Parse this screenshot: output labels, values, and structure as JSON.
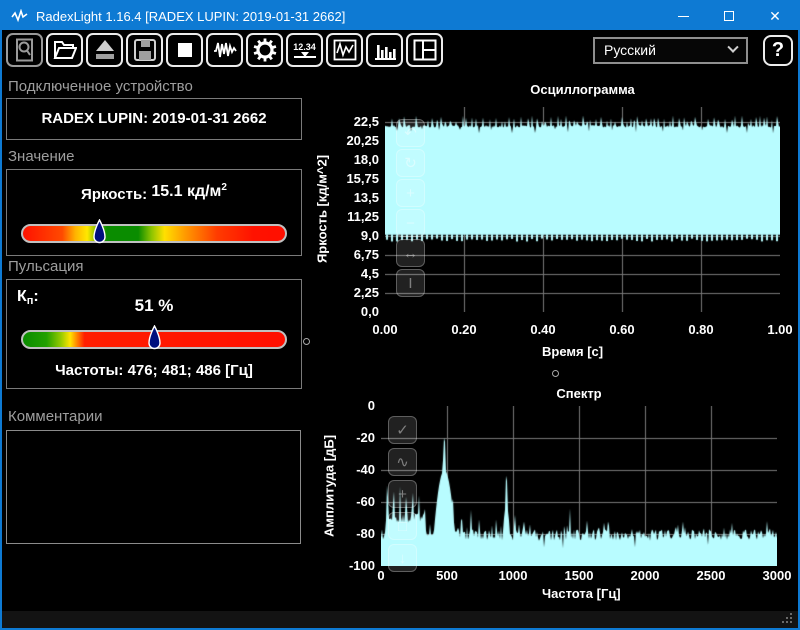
{
  "window": {
    "title": "RadexLight 1.16.4 [RADEX LUPIN: 2019-01-31 2662]",
    "controls": [
      "minimize",
      "maximize",
      "close"
    ]
  },
  "toolbar": {
    "icons": [
      "search-icon",
      "open-folder-icon",
      "eject-icon",
      "save-icon",
      "stop-icon",
      "waveform-icon",
      "gear-icon",
      "numeric-display-icon",
      "line-chart-icon",
      "bar-chart-icon",
      "layout-icon"
    ],
    "numeric_icon_text": "12.34",
    "language_value": "Русский",
    "help_label": "?"
  },
  "panels": {
    "device": {
      "header": "Подключенное устройство",
      "name": "RADEX LUPIN: 2019-01-31 2662"
    },
    "value": {
      "header": "Значение",
      "label": "Яркость:",
      "value": "15.1",
      "unit": "кд/м",
      "sup": "2",
      "bar": {
        "marker_pos_pct": 29,
        "marker_color": "#000f7e",
        "stops": [
          [
            0,
            "#ff1200"
          ],
          [
            0.15,
            "#ff4a00"
          ],
          [
            0.2,
            "#ffb300"
          ],
          [
            0.245,
            "#ffe800"
          ],
          [
            0.29,
            "#63b400"
          ],
          [
            0.32,
            "#0a8c00"
          ],
          [
            0.44,
            "#0a8c00"
          ],
          [
            0.49,
            "#8cc400"
          ],
          [
            0.54,
            "#ffe000"
          ],
          [
            0.62,
            "#ff9900"
          ],
          [
            0.74,
            "#ff3c00"
          ],
          [
            0.88,
            "#ff1200"
          ],
          [
            1,
            "#ff0f00"
          ]
        ]
      }
    },
    "pulsation": {
      "header": "Пульсация",
      "kp_letter": "К",
      "kp_sub": "п",
      "kp_colon": ":",
      "value": "51 %",
      "frequencies": "Частоты: 476; 481; 486 [Гц]",
      "bar": {
        "marker_pos_pct": 50,
        "marker_color": "#000f7e",
        "stops": [
          [
            0,
            "#0a8c00"
          ],
          [
            0.09,
            "#23a000"
          ],
          [
            0.145,
            "#96ca00"
          ],
          [
            0.18,
            "#ffe400"
          ],
          [
            0.205,
            "#ff8800"
          ],
          [
            0.235,
            "#ff1e00"
          ],
          [
            1,
            "#ff0f00"
          ]
        ]
      }
    },
    "comments": {
      "header": "Комментарии",
      "text": ""
    }
  },
  "charts": {
    "oscillogram": {
      "type": "area",
      "title": "Осциллограмма",
      "ylabel": "Яркость [кд/м^2]",
      "xlabel": "Время [с]",
      "y_ticks": [
        "22,5",
        "20,25",
        "18,0",
        "15,75",
        "13,5",
        "11,25",
        "9,0",
        "6,75",
        "4,5",
        "2,25",
        "0,0"
      ],
      "y_tick_values": [
        22.5,
        20.25,
        18.0,
        15.75,
        13.5,
        11.25,
        9.0,
        6.75,
        4.5,
        2.25,
        0.0
      ],
      "x_ticks": [
        "0.00",
        "0.20",
        "0.40",
        "0.60",
        "0.80",
        "1.00"
      ],
      "x_tick_values": [
        0,
        0.2,
        0.4,
        0.6,
        0.8,
        1.0
      ],
      "xlim": [
        0,
        1
      ],
      "ylim": [
        0,
        24.3
      ],
      "grid_color": "#787878",
      "fill_color": "#b8fcff",
      "band": {
        "top_mean": 22.0,
        "spike_max": 23.3,
        "bottom_base": 9.15,
        "teeth_min": 8.35
      },
      "tools": [
        {
          "name": "undo-icon",
          "glyph": "↶"
        },
        {
          "name": "refresh-icon",
          "glyph": "↻"
        },
        {
          "name": "zoom-in-icon",
          "glyph": "+"
        },
        {
          "name": "zoom-out-icon",
          "glyph": "−"
        },
        {
          "name": "expand-icon",
          "glyph": "↔"
        },
        {
          "name": "cursor-icon",
          "glyph": "I"
        }
      ]
    },
    "spectrum": {
      "type": "area",
      "title": "Спектр",
      "ylabel": "Амплитуда [дБ]",
      "xlabel": "Частота [Гц]",
      "y_ticks": [
        "0",
        "-20",
        "-40",
        "-60",
        "-80",
        "-100"
      ],
      "y_tick_values": [
        0,
        -20,
        -40,
        -60,
        -80,
        -100
      ],
      "x_ticks": [
        "0",
        "500",
        "1000",
        "1500",
        "2000",
        "2500",
        "3000"
      ],
      "x_tick_values": [
        0,
        500,
        1000,
        1500,
        2000,
        2500,
        3000
      ],
      "xlim": [
        0,
        3000
      ],
      "ylim": [
        -100,
        0
      ],
      "grid_color": "#787878",
      "fill_color": "#b8fcff",
      "noise_floor_db": -81,
      "peaks": [
        {
          "hz": 48,
          "db": -47,
          "width": 6
        },
        {
          "hz": 96,
          "db": -51,
          "width": 6
        },
        {
          "hz": 144,
          "db": -50,
          "width": 6
        },
        {
          "hz": 192,
          "db": -54,
          "width": 6
        },
        {
          "hz": 240,
          "db": -52,
          "width": 6
        },
        {
          "hz": 288,
          "db": -56,
          "width": 6
        },
        {
          "hz": 330,
          "db": -60,
          "width": 6
        },
        {
          "hz": 480,
          "db": -19,
          "width": 10,
          "skirt": 60
        },
        {
          "hz": 545,
          "db": -58,
          "width": 5
        },
        {
          "hz": 610,
          "db": -63,
          "width": 5
        },
        {
          "hz": 680,
          "db": -63,
          "width": 5
        },
        {
          "hz": 745,
          "db": -67,
          "width": 5
        },
        {
          "hz": 870,
          "db": -70,
          "width": 5
        },
        {
          "hz": 950,
          "db": -41,
          "width": 7,
          "skirt": 30
        },
        {
          "hz": 1015,
          "db": -68,
          "width": 5
        },
        {
          "hz": 1080,
          "db": -66,
          "width": 5
        },
        {
          "hz": 1430,
          "db": -62,
          "width": 5
        },
        {
          "hz": 1650,
          "db": -75,
          "width": 6
        },
        {
          "hz": 1900,
          "db": -76,
          "width": 6
        },
        {
          "hz": 2250,
          "db": -74,
          "width": 6
        },
        {
          "hz": 2600,
          "db": -75,
          "width": 6
        },
        {
          "hz": 2950,
          "db": -73,
          "width": 6
        }
      ],
      "tools": [
        {
          "name": "check-icon",
          "glyph": "✓"
        },
        {
          "name": "curve-icon",
          "glyph": "∿"
        },
        {
          "name": "plus-icon",
          "glyph": "+"
        },
        {
          "name": "box-icon",
          "glyph": "□"
        },
        {
          "name": "download-icon",
          "glyph": "↓"
        }
      ]
    }
  },
  "colors": {
    "accent": "#0e7ad3",
    "chart_fill": "#b8fcff",
    "grid": "#787878",
    "section_header": "#9e9e9e"
  }
}
